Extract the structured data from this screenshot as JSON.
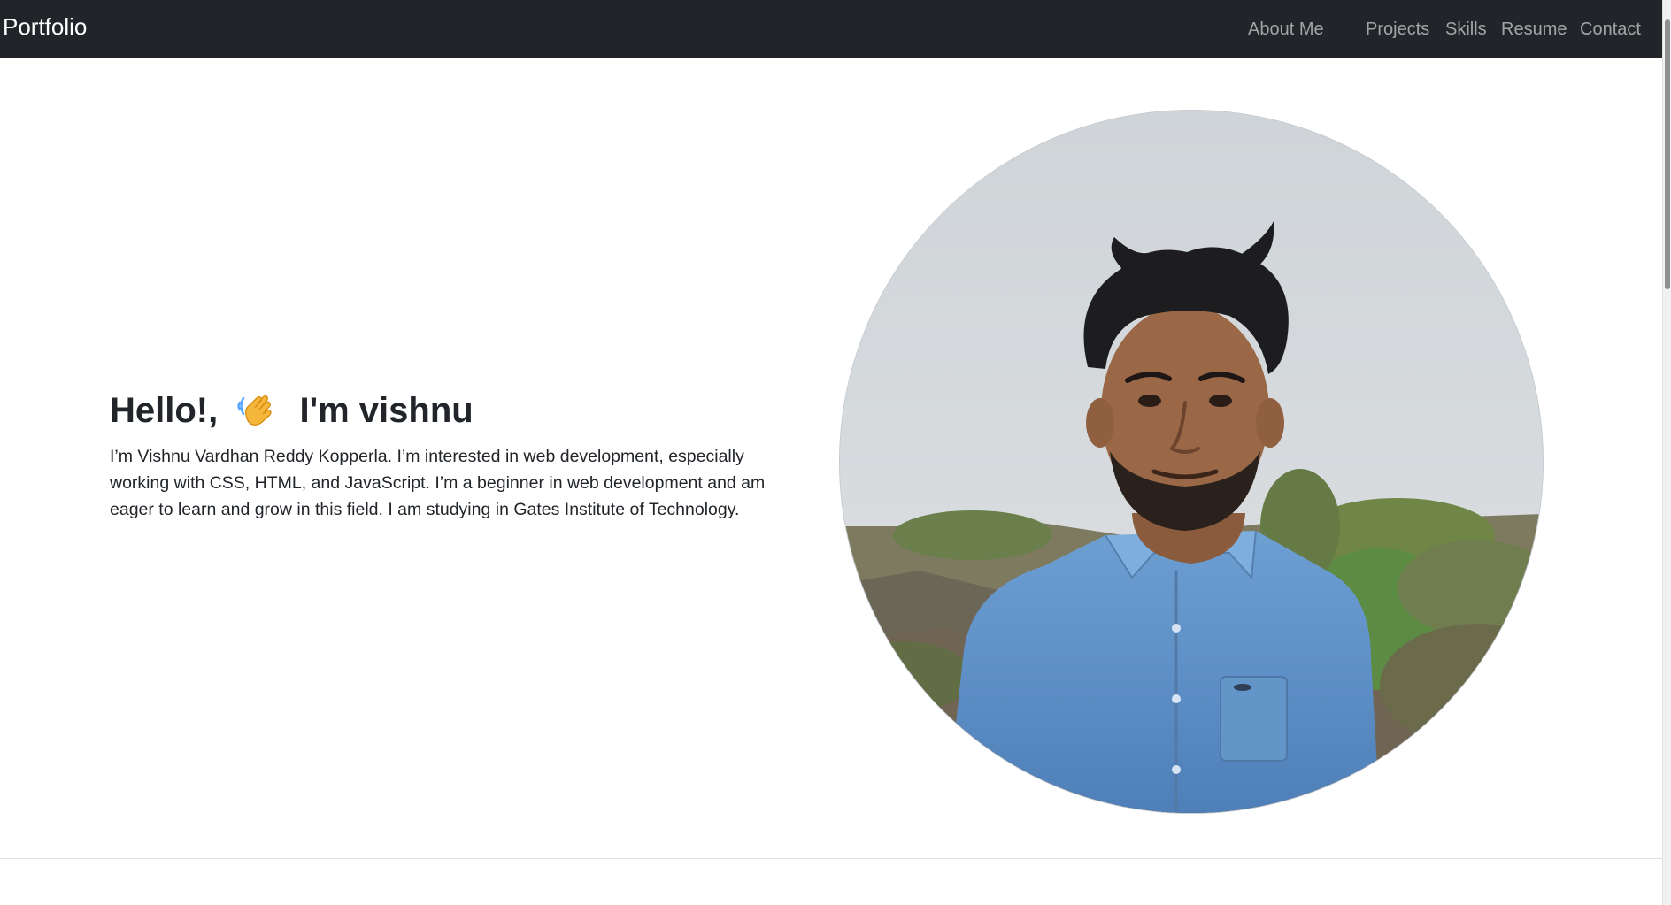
{
  "navbar": {
    "brand": "Portfolio",
    "links": [
      "About Me",
      "Projects",
      "Skills",
      "Resume",
      "Contact"
    ],
    "background_color": "#212529"
  },
  "hero": {
    "greeting": "Hello!,",
    "wave_emoji": "👋",
    "name_line": "I'm vishnu",
    "intro": "I’m Vishnu Vardhan Reddy Kopperla. I’m interested in web development, especially working with CSS, HTML, and JavaScript. I’m a beginner in web development and am eager to learn and grow in this field. I am studying in Gates Institute of Technology.",
    "photo_icon": "profile-photo"
  }
}
